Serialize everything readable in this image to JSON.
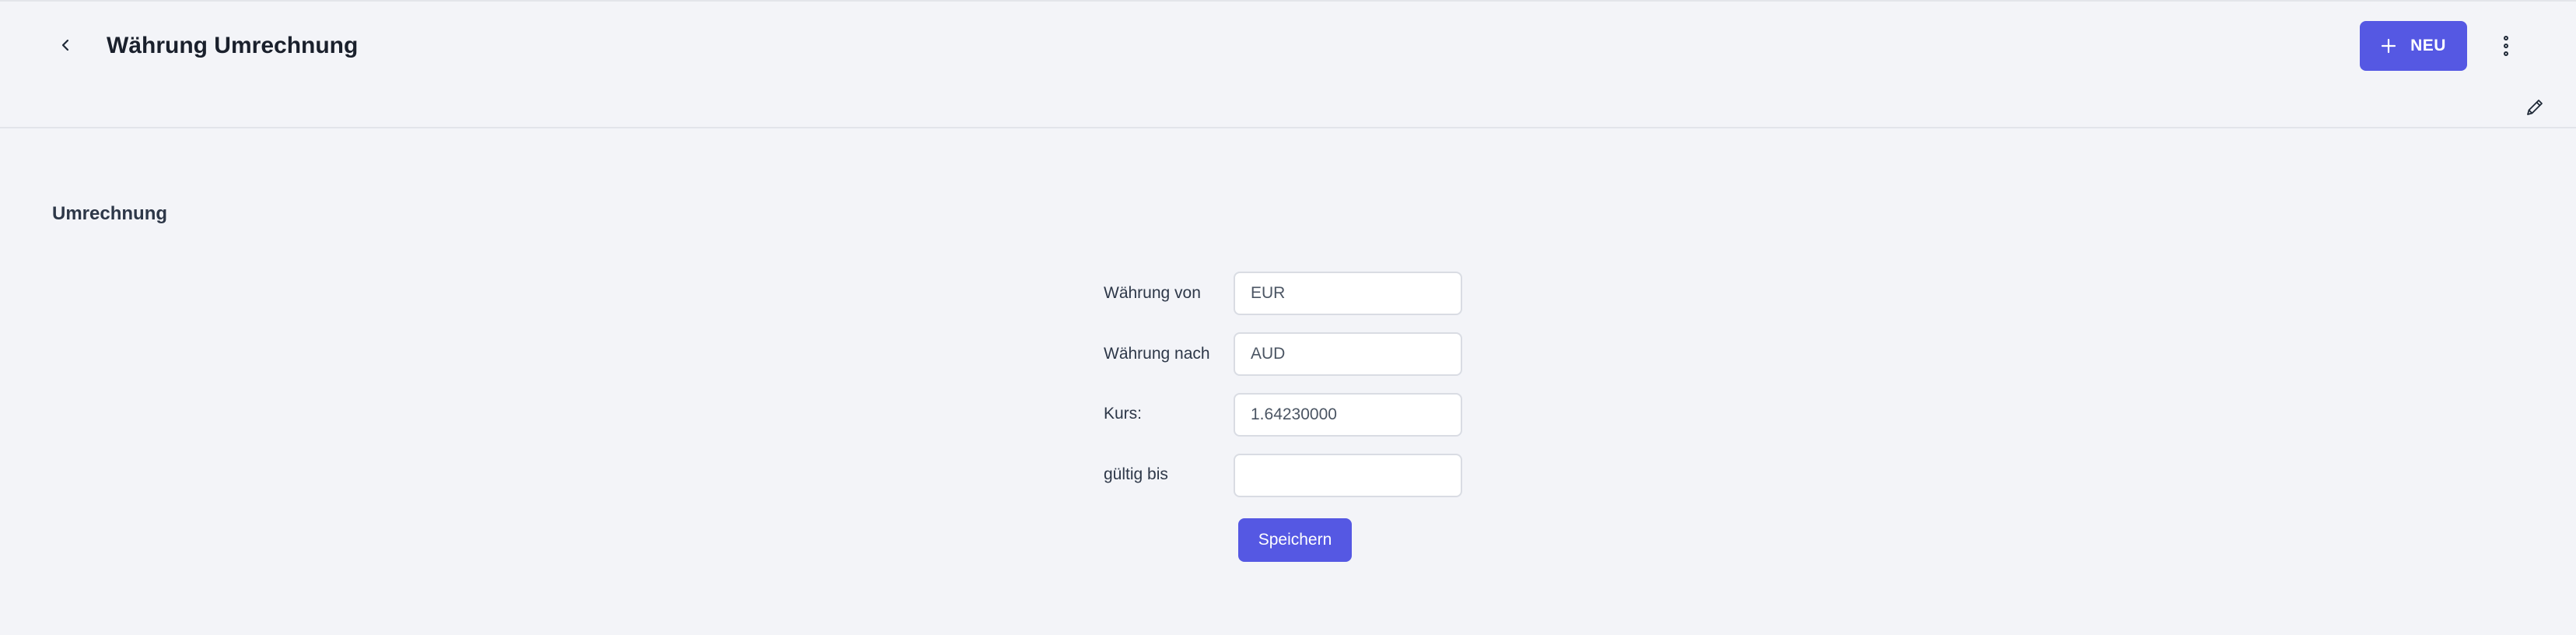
{
  "header": {
    "title": "Währung Umrechnung",
    "new_button_label": "NEU",
    "icons": {
      "back": "chevron-left-icon",
      "add": "plus-icon",
      "more": "kebab-vertical-icon",
      "edit": "pencil-icon"
    }
  },
  "section": {
    "title": "Umrechnung"
  },
  "form": {
    "fields": [
      {
        "label": "Währung von",
        "value": "EUR"
      },
      {
        "label": "Währung nach",
        "value": "AUD"
      },
      {
        "label": "Kurs:",
        "value": "1.64230000"
      },
      {
        "label": "gültig bis",
        "value": ""
      }
    ],
    "save_label": "Speichern"
  },
  "colors": {
    "background": "#f3f4f8",
    "accent": "#5558e3",
    "border": "#d9dce3",
    "text": "#1f2937"
  }
}
